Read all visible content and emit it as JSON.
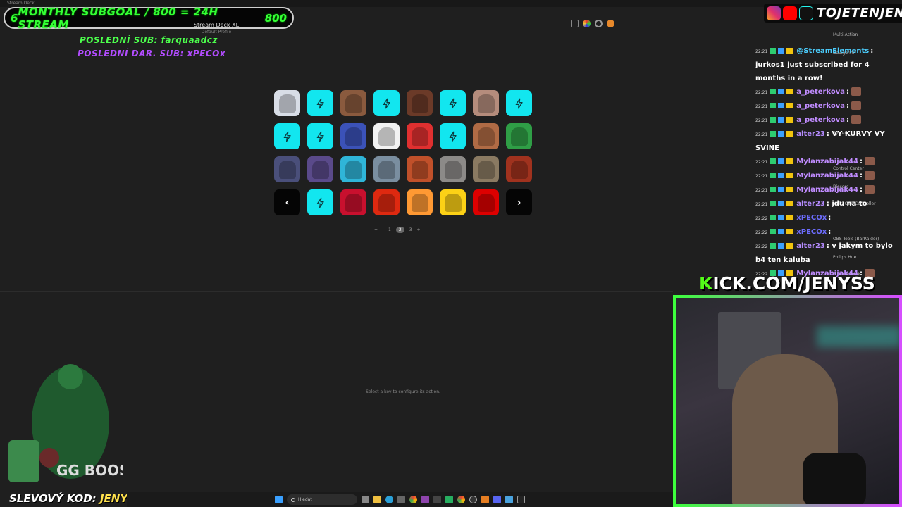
{
  "window": {
    "title": "Stream Deck"
  },
  "subgoal": {
    "left_count": "6",
    "text": "MONTHLY SUBGOAL / 800 = 24H STREAM",
    "right_count": "800"
  },
  "device": {
    "name": "Stream Deck XL",
    "profile": "Default Profile"
  },
  "overlay": {
    "last_sub": "POSLEDNÍ SUB: farquaadcz",
    "last_donation": "POSLEDNÍ DAR. SUB: xPECOx"
  },
  "deck": {
    "keys": [
      {
        "kind": "img",
        "icon": "figure-photo-icon",
        "color": "#d8dde6"
      },
      {
        "kind": "bolt",
        "icon": "lightning-icon"
      },
      {
        "kind": "img",
        "icon": "man-photo-icon",
        "color": "#8a5a3e"
      },
      {
        "kind": "bolt",
        "icon": "lightning-icon"
      },
      {
        "kind": "img",
        "icon": "trophy-photo-icon",
        "color": "#6b3a28"
      },
      {
        "kind": "bolt",
        "icon": "lightning-icon"
      },
      {
        "kind": "img",
        "icon": "face-photo-icon",
        "color": "#b58c7c"
      },
      {
        "kind": "bolt",
        "icon": "lightning-icon"
      },
      {
        "kind": "bolt",
        "icon": "lightning-icon"
      },
      {
        "kind": "bolt",
        "icon": "lightning-icon"
      },
      {
        "kind": "img",
        "icon": "rainbow-bag-icon",
        "color": "#3b52b8"
      },
      {
        "kind": "img",
        "icon": "gaaayy-meme-icon",
        "color": "#f2f2f2"
      },
      {
        "kind": "img",
        "icon": "card-photo-icon",
        "color": "#e03030"
      },
      {
        "kind": "bolt",
        "icon": "lightning-icon"
      },
      {
        "kind": "img",
        "icon": "face-closeup-icon",
        "color": "#b06b45"
      },
      {
        "kind": "img",
        "icon": "wrestler-photo-icon",
        "color": "#2f9e46"
      },
      {
        "kind": "img",
        "icon": "man-suit-icon",
        "color": "#4a4f7a"
      },
      {
        "kind": "img",
        "icon": "couple-photo-icon",
        "color": "#5a4a8a"
      },
      {
        "kind": "img",
        "icon": "spongebob-icon",
        "color": "#2fb5d8"
      },
      {
        "kind": "img",
        "icon": "helicopter-icon",
        "color": "#7a8ea0"
      },
      {
        "kind": "img",
        "icon": "player-photo-icon",
        "color": "#c0502a"
      },
      {
        "kind": "img",
        "icon": "soldier-photo-icon",
        "color": "#8c8a88"
      },
      {
        "kind": "img",
        "icon": "statue-photo-icon",
        "color": "#8a7a62"
      },
      {
        "kind": "img",
        "icon": "fire-photo-icon",
        "color": "#a0321e"
      },
      {
        "kind": "nav",
        "icon": "chevron-left-icon",
        "label": "‹"
      },
      {
        "kind": "bolt",
        "icon": "lightning-icon"
      },
      {
        "kind": "img",
        "icon": "uk-rainbow-flag-icon",
        "color": "#c8102e"
      },
      {
        "kind": "img",
        "icon": "china-flag-icon",
        "color": "#de2910"
      },
      {
        "kind": "img",
        "icon": "india-flag-icon",
        "color": "#ff9933"
      },
      {
        "kind": "img",
        "icon": "colombia-flag-icon",
        "color": "#fcd116"
      },
      {
        "kind": "img",
        "icon": "germany-flag-icon",
        "color": "#dd0000"
      },
      {
        "kind": "nav",
        "icon": "chevron-right-icon",
        "label": "›"
      }
    ]
  },
  "pager": {
    "prev": "+",
    "pages": [
      "1",
      "2",
      "3"
    ],
    "current": "2",
    "next": "+"
  },
  "hint": "Select a key to configure its action.",
  "rpanel": [
    "Multi Action",
    "Navigation",
    "System",
    "Control Center",
    "Discord",
    "Multi OBS Controller",
    "OBS Tools (BarRaider)",
    "Philips Hue",
    "Stream Deck"
  ],
  "socials": {
    "handle": "TOJETENJENYS"
  },
  "chat": [
    {
      "time": "22:21",
      "user": "@StreamElements",
      "color": "#4ccfff",
      "text": ": jurkos1 just subscribed for 4 months in a row!",
      "emote": false
    },
    {
      "time": "22:21",
      "user": "a_peterkova",
      "color": "#c08cff",
      "text": ":",
      "emote": true
    },
    {
      "time": "22:21",
      "user": "a_peterkova",
      "color": "#c08cff",
      "text": ":",
      "emote": true
    },
    {
      "time": "22:21",
      "user": "a_peterkova",
      "color": "#c08cff",
      "text": ":",
      "emote": true
    },
    {
      "time": "22:21",
      "user": "alter23",
      "color": "#b58cff",
      "text": ": VY KURVY VY SVINE",
      "emote": false
    },
    {
      "time": "22:21",
      "user": "Mylanzabijak44",
      "color": "#c08cff",
      "text": ":",
      "emote": true
    },
    {
      "time": "22:21",
      "user": "Mylanzabijak44",
      "color": "#c08cff",
      "text": ":",
      "emote": true
    },
    {
      "time": "22:21",
      "user": "Mylanzabijak44",
      "color": "#c08cff",
      "text": ":",
      "emote": true
    },
    {
      "time": "22:21",
      "user": "alter23",
      "color": "#b58cff",
      "text": ": jdu na to",
      "emote": false
    },
    {
      "time": "22:22",
      "user": "xPECOx",
      "color": "#6d6dff",
      "text": ":",
      "emote": false
    },
    {
      "time": "22:22",
      "user": "xPECOx",
      "color": "#6d6dff",
      "text": ":",
      "emote": false
    },
    {
      "time": "22:22",
      "user": "alter23",
      "color": "#b58cff",
      "text": ": v jakym to bylo b4 ten kaluba",
      "emote": false
    },
    {
      "time": "22:22",
      "user": "Mylanzabijak44",
      "color": "#c08cff",
      "text": ":",
      "emote": true
    }
  ],
  "kick": {
    "k": "K",
    "rest": "ICK.COM/JENYSS"
  },
  "promo": {
    "label": "SLEVOVÝ KOD:",
    "code": "JENYS"
  },
  "mascot": {
    "brand": "GG BOOSTER"
  },
  "taskbar": {
    "search": "Hledat"
  }
}
